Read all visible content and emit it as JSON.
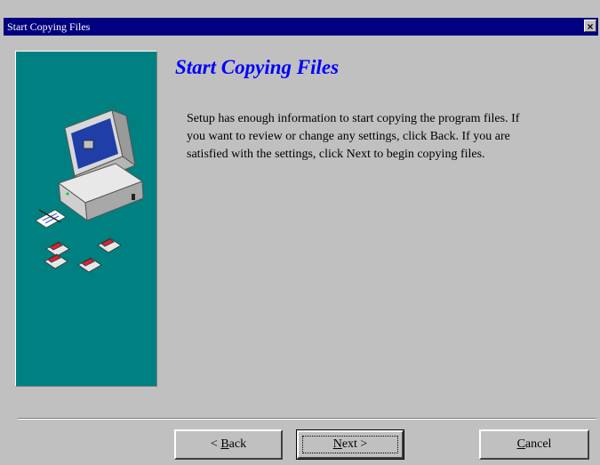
{
  "window": {
    "title": "Start Copying Files",
    "close_symbol": "×"
  },
  "main": {
    "heading": "Start Copying Files",
    "body_lines": [
      "Setup has enough information to start copying the program files.  If",
      "you want to review or change any settings, click Back.  If you are",
      "satisfied with the settings, click Next to begin copying files."
    ]
  },
  "buttons": {
    "back_prefix": "< ",
    "back_mnemonic": "B",
    "back_rest": "ack",
    "next_mnemonic": "N",
    "next_rest": "ext >",
    "cancel_mnemonic": "C",
    "cancel_rest": "ancel"
  },
  "icons": {
    "side_illustration": "computer-with-floppy-disks-illustration",
    "close": "close-icon"
  },
  "colors": {
    "titlebar": "#000080",
    "panel": "#008080",
    "heading": "#0000ff",
    "background": "#c0c0c0"
  }
}
